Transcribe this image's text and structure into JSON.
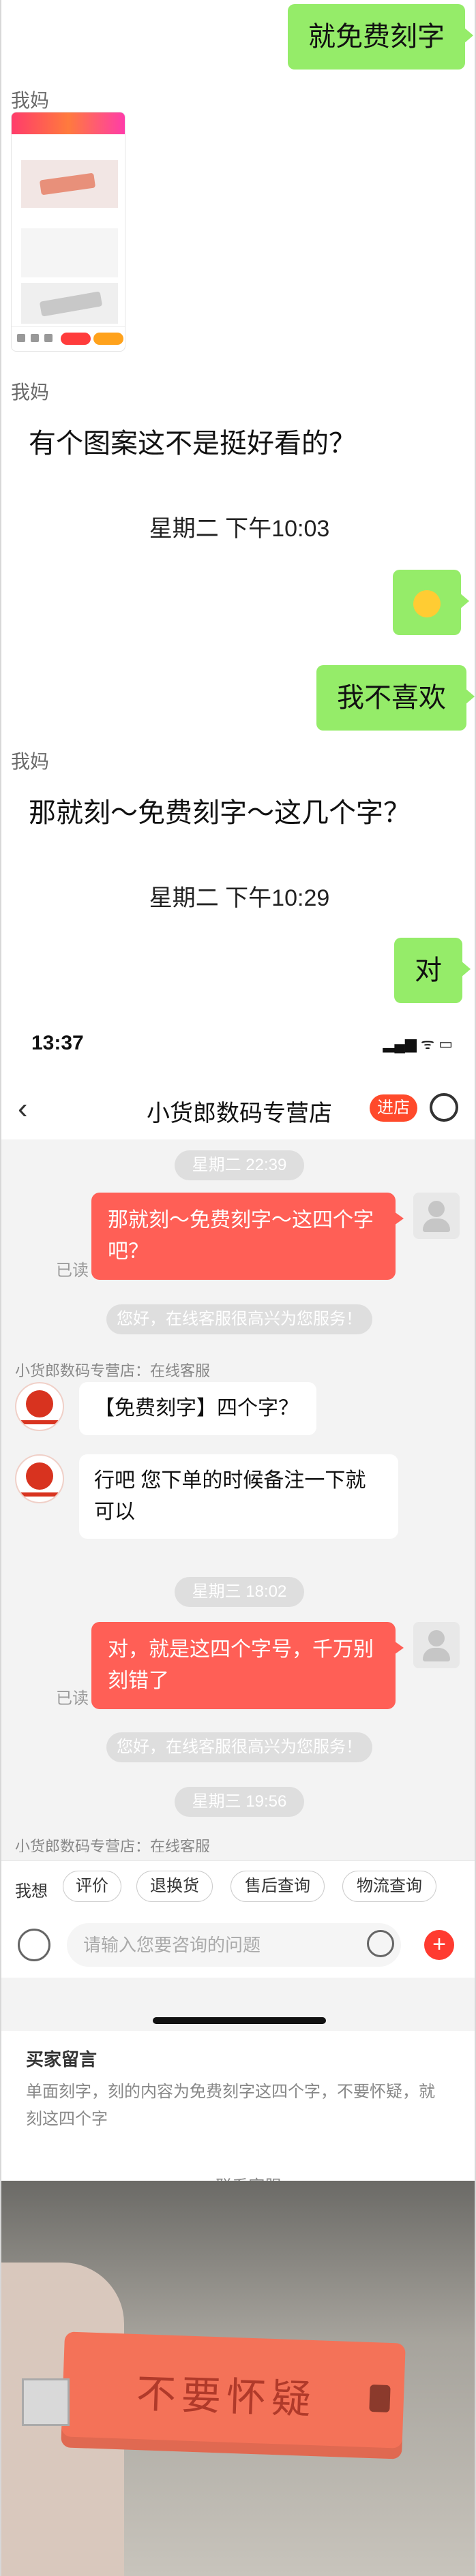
{
  "wechat": {
    "msg1": "就免费刻字",
    "sender1": "我妈",
    "sender2": "我妈",
    "mom_msg1": "有个图案这不是挺好看的？",
    "time1": "星期二 下午10:03",
    "emoji": "😟",
    "msg2": "我不喜欢",
    "sender3": "我妈",
    "mom_msg2": "那就刻～免费刻字～这几个字？",
    "time2": "星期二 下午10:29",
    "msg3": "对"
  },
  "taobao": {
    "status_time": "13:37",
    "status_icons": "▂▄▆ ᯤ ▭",
    "back": "‹",
    "title": "小货郎数码专营店",
    "enter_store": "进店",
    "time_a": "星期二 22:39",
    "user_msg1": "那就刻～免费刻字～这四个字吧？",
    "read1": "已读",
    "welcome1": "您好，在线客服很高兴为您服务！",
    "shop_label1": "小货郎数码专营店：在线客服",
    "shop_msg1": "【免费刻字】四个字？",
    "shop_msg2": "行吧  您下单的时候备注一下就可以",
    "time_b": "星期三 18:02",
    "user_msg2": "对，就是这四个字号，千万别刻错了",
    "read2": "已读",
    "welcome2": "您好，在线客服很高兴为您服务！",
    "time_c": "星期三 19:56",
    "shop_label2": "小货郎数码专营店：在线客服",
    "quick_label": "我想",
    "quick": [
      "评价",
      "退换货",
      "售后查询",
      "物流查询"
    ],
    "input_placeholder": "请输入您要咨询的问题",
    "plus": "+",
    "buyer_title": "买家留言",
    "buyer_text": "单面刻字，刻的内容为免费刻字这四个字，不要怀疑，就刻这四个字",
    "contact": "⊙ 联系客服"
  },
  "photo": {
    "engraving": "不要怀疑"
  }
}
